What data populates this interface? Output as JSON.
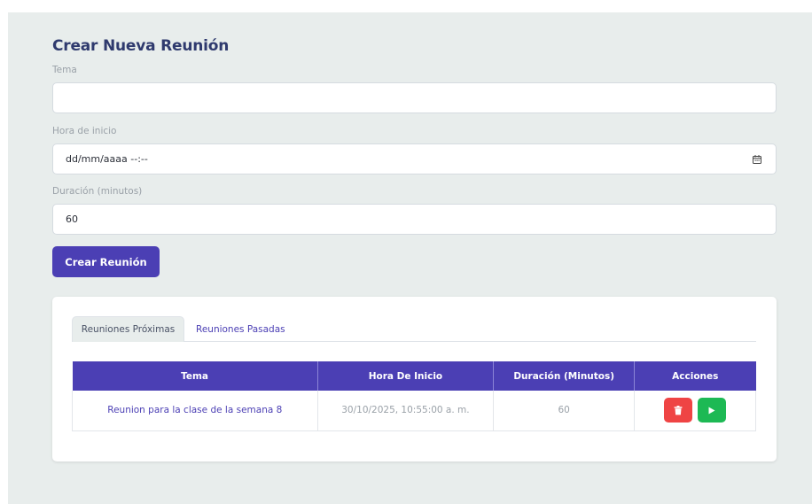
{
  "form": {
    "title": "Crear Nueva Reunión",
    "topic_label": "Tema",
    "topic_value": "",
    "start_label": "Hora de inicio",
    "start_value": "dd/mm/aaaa --:--",
    "duration_label": "Duración (minutos)",
    "duration_value": "60",
    "submit_label": "Crear Reunión"
  },
  "meetings": {
    "tabs": [
      {
        "label": "Reuniones Próximas",
        "active": true
      },
      {
        "label": "Reuniones Pasadas",
        "active": false
      }
    ],
    "columns": [
      "Tema",
      "Hora De Inicio",
      "Duración (Minutos)",
      "Acciones"
    ],
    "rows": [
      {
        "topic": "Reunion para la clase de la semana 8",
        "start": "30/10/2025, 10:55:00 a. m.",
        "duration": "60",
        "actions": [
          "trash-icon",
          "play-icon"
        ]
      }
    ]
  },
  "colors": {
    "primary": "#4b3fb4",
    "delete": "#ef4444",
    "start": "#1db954",
    "panel_bg": "#e8edec"
  }
}
